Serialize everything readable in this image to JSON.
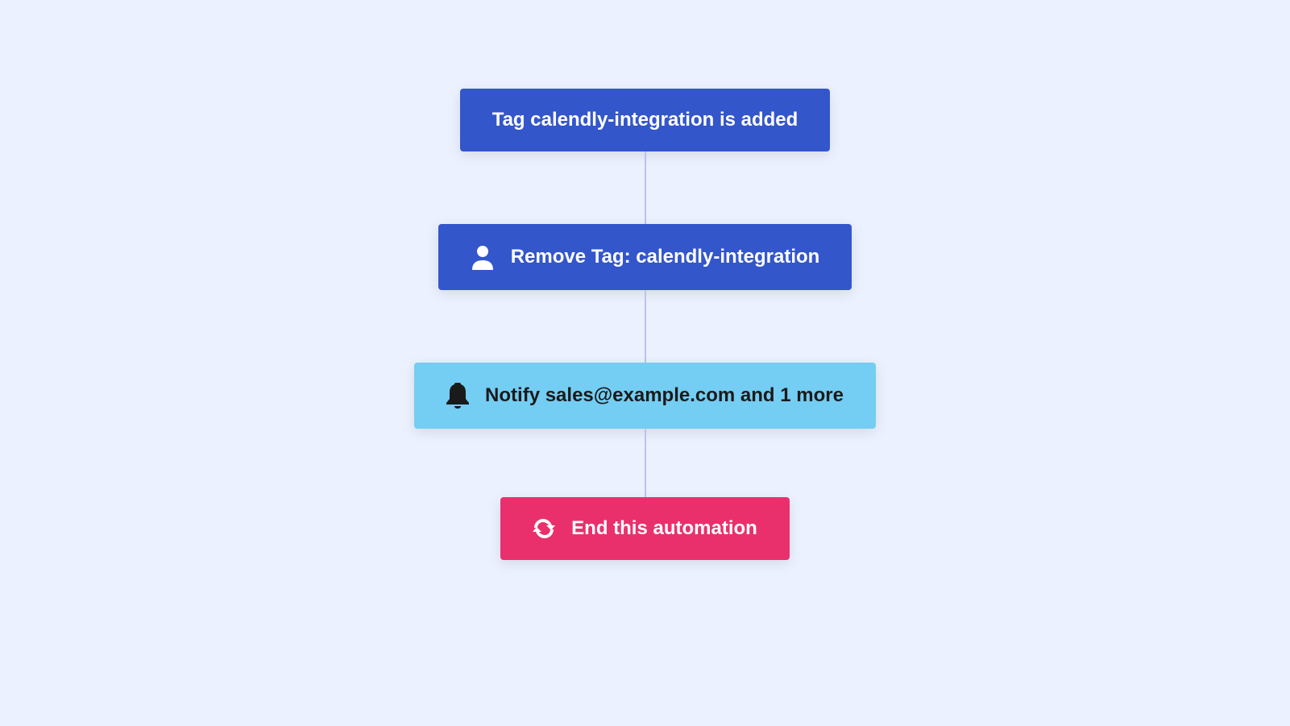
{
  "flow": {
    "trigger": {
      "label": "Tag calendly-integration is added"
    },
    "steps": [
      {
        "icon": "user-icon",
        "label": "Remove Tag: calendly-integration",
        "style": "blue"
      },
      {
        "icon": "bell-icon",
        "label": "Notify sales@example.com and 1 more",
        "style": "light"
      }
    ],
    "end": {
      "icon": "refresh-icon",
      "label": "End this automation"
    }
  },
  "colors": {
    "background": "#ebf1fe",
    "primary_blue": "#3356cb",
    "light_blue": "#74cdf2",
    "pink": "#e9306d",
    "connector": "#b8c6e8"
  }
}
